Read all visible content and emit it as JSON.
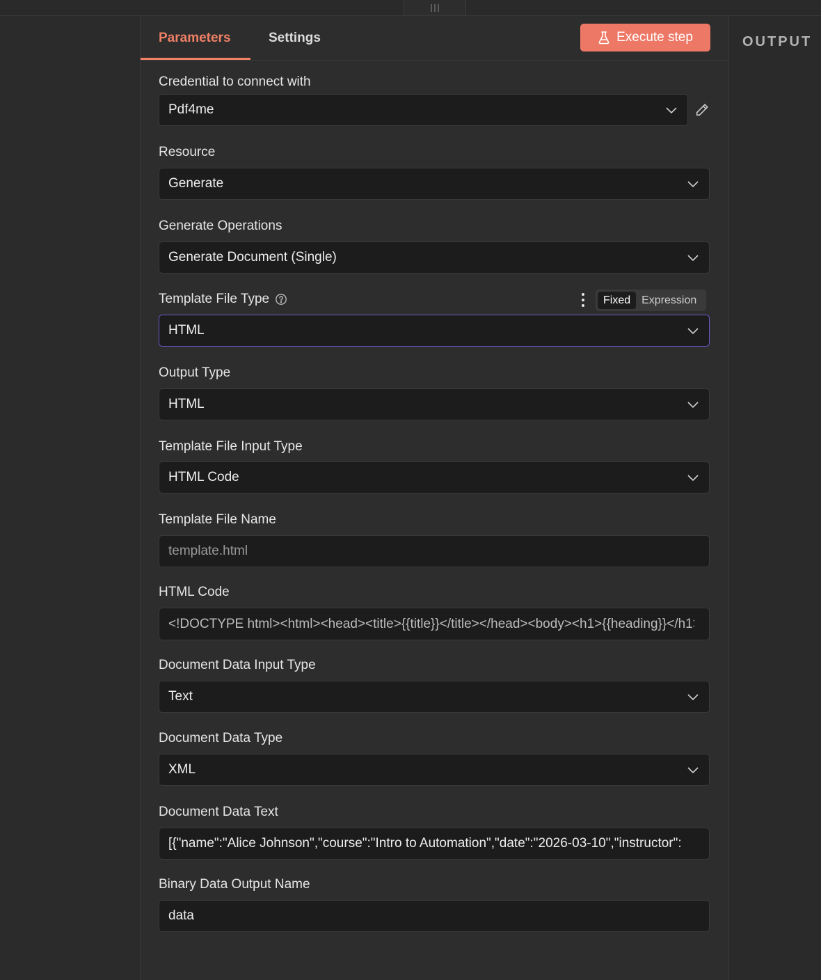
{
  "tabs": {
    "parameters": "Parameters",
    "settings": "Settings"
  },
  "execute_button": {
    "label": "Execute step",
    "color": "#ee7866"
  },
  "accent_color": "#f08066",
  "output_panel": {
    "title": "OUTPUT"
  },
  "fields": {
    "credential": {
      "label": "Credential to connect with",
      "value": "Pdf4me"
    },
    "resource": {
      "label": "Resource",
      "value": "Generate"
    },
    "operation": {
      "label": "Generate Operations",
      "value": "Generate Document (Single)"
    },
    "template_file_type": {
      "label": "Template File Type",
      "value": "HTML",
      "mode_fixed": "Fixed",
      "mode_expression": "Expression"
    },
    "output_type": {
      "label": "Output Type",
      "value": "HTML"
    },
    "template_input_type": {
      "label": "Template File Input Type",
      "value": "HTML Code"
    },
    "template_file_name": {
      "label": "Template File Name",
      "placeholder": "template.html"
    },
    "html_code": {
      "label": "HTML Code",
      "value": "<!DOCTYPE html><html><head><title>{{title}}</title></head><body><h1>{{heading}}</h1>"
    },
    "data_input_type": {
      "label": "Document Data Input Type",
      "value": "Text"
    },
    "data_type": {
      "label": "Document Data Type",
      "value": "XML"
    },
    "data_text": {
      "label": "Document Data Text",
      "value": "[{\"name\":\"Alice Johnson\",\"course\":\"Intro to Automation\",\"date\":\"2026-03-10\",\"instructor\":"
    },
    "binary_output_name": {
      "label": "Binary Data Output Name",
      "value": "data"
    }
  },
  "icons": {
    "execute": "flask-icon",
    "edit": "pencil-icon",
    "dropdown": "chevron-down-icon",
    "help": "question-circle-icon",
    "menu": "kebab-menu-icon"
  }
}
